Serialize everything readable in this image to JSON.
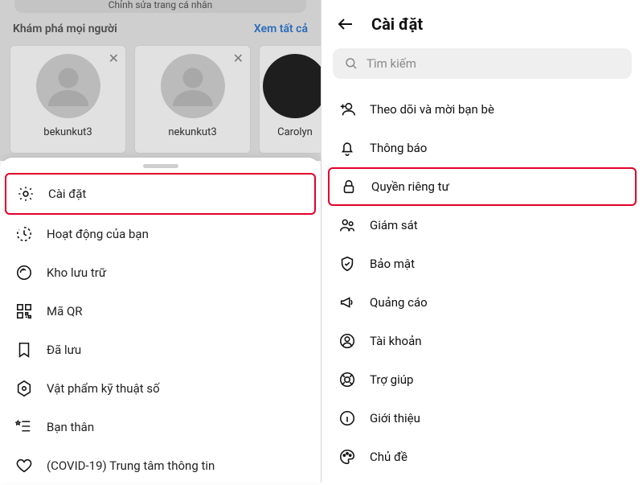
{
  "left": {
    "top_pill": "Chỉnh sửa trang cá nhân",
    "discover_title": "Khám phá mọi người",
    "see_all": "Xem tất cả",
    "cards": [
      {
        "username": "bekunkut3"
      },
      {
        "username": "nekunkut3"
      },
      {
        "username": "Carolyn"
      }
    ],
    "sheet_items": [
      {
        "label": "Cài đặt",
        "highlighted": true
      },
      {
        "label": "Hoạt động của bạn"
      },
      {
        "label": "Kho lưu trữ"
      },
      {
        "label": "Mã QR"
      },
      {
        "label": "Đã lưu"
      },
      {
        "label": "Vật phẩm kỹ thuật số"
      },
      {
        "label": "Bạn thân"
      },
      {
        "label": "(COVID-19) Trung tâm thông tin"
      }
    ]
  },
  "right": {
    "title": "Cài đặt",
    "search_placeholder": "Tìm kiếm",
    "items": [
      {
        "label": "Theo dõi và mời bạn bè"
      },
      {
        "label": "Thông báo"
      },
      {
        "label": "Quyền riêng tư",
        "highlighted": true
      },
      {
        "label": "Giám sát"
      },
      {
        "label": "Bảo mật"
      },
      {
        "label": "Quảng cáo"
      },
      {
        "label": "Tài khoản"
      },
      {
        "label": "Trợ giúp"
      },
      {
        "label": "Giới thiệu"
      },
      {
        "label": "Chủ đề"
      }
    ]
  }
}
